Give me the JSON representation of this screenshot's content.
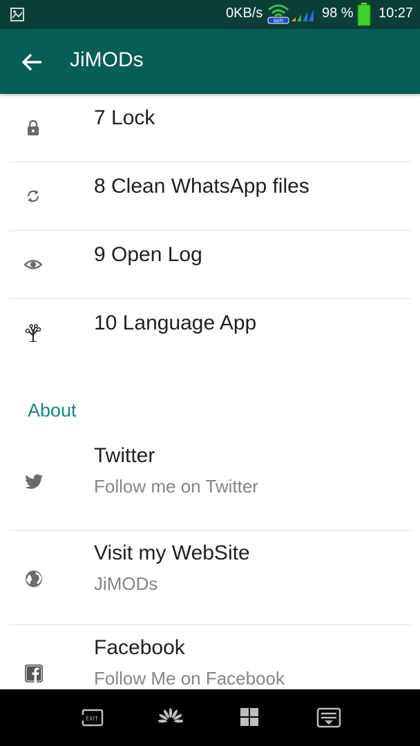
{
  "status_bar": {
    "network_speed": "0KB/s",
    "battery_percent": "98 %",
    "time": "10:27",
    "icons": [
      "image-icon",
      "wifi-icon",
      "signal-icon",
      "battery-icon"
    ]
  },
  "app_bar": {
    "title": "JiMODs",
    "back_icon": "back-arrow-icon"
  },
  "items": [
    {
      "number_label": "7 Lock",
      "icon": "lock-icon"
    },
    {
      "number_label": "8 Clean WhatsApp files",
      "icon": "sync-icon"
    },
    {
      "number_label": "9 Open Log",
      "icon": "eye-icon"
    },
    {
      "number_label": "10 Language App",
      "icon": "tree-icon"
    }
  ],
  "about": {
    "header": "About",
    "items": [
      {
        "title": "Twitter",
        "subtitle": "Follow me on Twitter",
        "icon": "twitter-icon"
      },
      {
        "title": "Visit my WebSite",
        "subtitle": "JiMODs",
        "icon": "globe-icon"
      },
      {
        "title": "Facebook",
        "subtitle": "Follow Me on Facebook",
        "icon": "facebook-icon"
      }
    ]
  },
  "nav_bar": {
    "exit_label": "EXIT",
    "icons": [
      "exit-icon",
      "huawei-logo-icon",
      "apps-grid-icon",
      "notification-panel-icon"
    ]
  },
  "colors": {
    "status_bar": "#0a3e36",
    "app_bar": "#075e54",
    "accent": "#0f8a7d",
    "icon_gray": "#6b6b6b"
  }
}
